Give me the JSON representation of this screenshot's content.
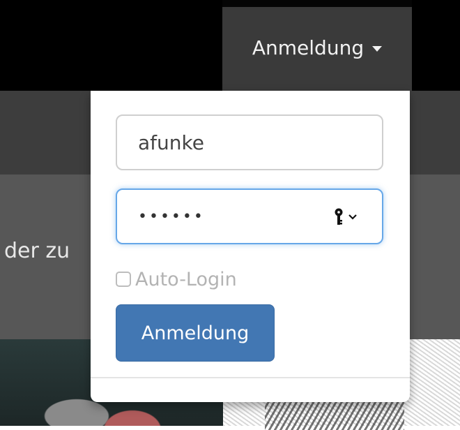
{
  "nav": {
    "login_dropdown_label": "Anmeldung"
  },
  "content": {
    "partial_text": "der zu"
  },
  "login_form": {
    "username_value": "afunke",
    "password_value": "••••••",
    "autologin_label": "Auto-Login",
    "autologin_checked": false,
    "submit_label": "Anmeldung"
  },
  "icons": {
    "dropdown_caret": "caret-down-icon",
    "password_manager": "key-icon",
    "password_manager_chevron": "chevron-down-icon"
  },
  "colors": {
    "primary_button": "#4277b3",
    "focus_border": "#66a7e8",
    "nav_active": "#3a3a3a"
  }
}
